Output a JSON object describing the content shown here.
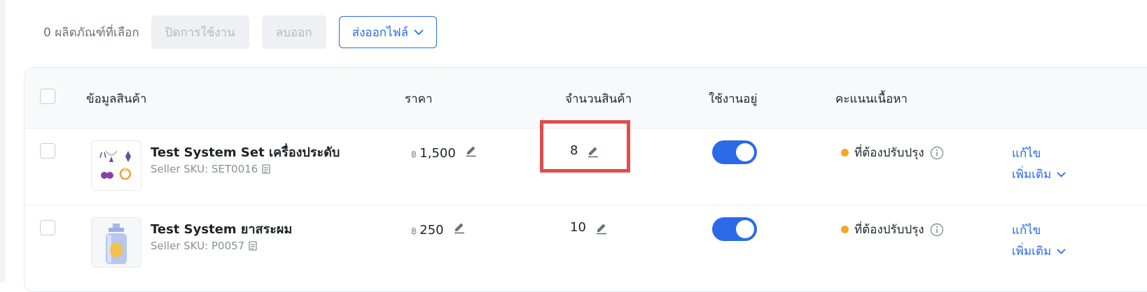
{
  "toolbar": {
    "selected_count": "0 ผลิตภัณฑ์ที่เลือก",
    "disable_label": "ปิดการใช้งาน",
    "delete_label": "ลบออก",
    "export_label": "ส่งออกไฟล์"
  },
  "table": {
    "columns": [
      "ข้อมูลสินค้า",
      "ราคา",
      "จำนวนสินค้า",
      "ใช้งานอยู่",
      "คะแนนเนื้อหา"
    ],
    "rows": [
      {
        "name": "Test System Set เครื่องประดับ",
        "sku": "Seller SKU: SET0016",
        "currency": "฿",
        "price": "1,500",
        "quantity": "8",
        "active": true,
        "status": "ที่ต้องปรับปรุง",
        "edit_label": "แก้ไข",
        "more_label": "เพิ่มเติม",
        "thumb_icon": "jewelry-set-image"
      },
      {
        "name": "Test System ยาสระผม",
        "sku": "Seller SKU: P0057",
        "currency": "฿",
        "price": "250",
        "quantity": "10",
        "active": true,
        "status": "ที่ต้องปรับปรุง",
        "edit_label": "แก้ไข",
        "more_label": "เพิ่มเติม",
        "thumb_icon": "shampoo-bottle-image"
      }
    ]
  },
  "colors": {
    "accent": "#2a6ae9",
    "status_warning": "#f5a623",
    "highlight": "#e24c4b"
  }
}
